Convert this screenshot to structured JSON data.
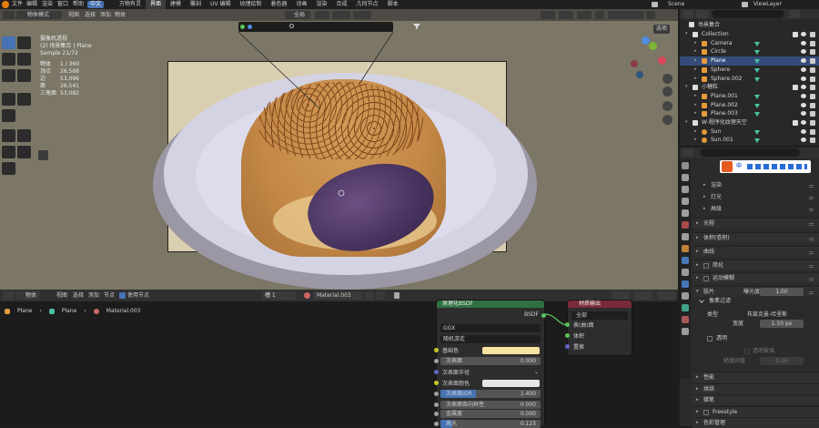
{
  "topbar": {
    "menus": [
      "文件",
      "编辑",
      "渲染",
      "窗口",
      "帮助"
    ],
    "lang_badge": "中文",
    "workspaces": [
      "万物有灵",
      "界面",
      "建模",
      "雕刻",
      "UV 编辑",
      "纹理绘制",
      "着色器",
      "动画",
      "渲染",
      "合成",
      "几何节点",
      "脚本"
    ],
    "scene_label": "Scene",
    "view_layer_label": "ViewLayer"
  },
  "viewport_header": {
    "mode": "物体模式",
    "menus": [
      "视图",
      "选择",
      "添加",
      "物体"
    ],
    "orientation": "全局",
    "options_label": "选项"
  },
  "viewport_info": {
    "view_name": "摄像机透视",
    "collection_line": "(2) 场景集合 | Plane",
    "sample": "Sample 21/72",
    "stats": [
      {
        "label": "物体",
        "value": "1 / 360"
      },
      {
        "label": "顶点",
        "value": "26,568"
      },
      {
        "label": "边",
        "value": "53,096"
      },
      {
        "label": "面",
        "value": "26,541"
      },
      {
        "label": "三角面",
        "value": "53,082"
      }
    ]
  },
  "node_header": {
    "mode": "物体",
    "menus": [
      "视图",
      "选择",
      "添加",
      "节点"
    ],
    "use_nodes_label": "使用节点",
    "slot": "槽 1",
    "material": "Material.003"
  },
  "breadcrumb": [
    "Plane",
    "Plane",
    "Material.003"
  ],
  "bsdf_node": {
    "title": "原理化BSDF",
    "output": "BSDF",
    "distribution": "GGX",
    "subsurface_method": "随机游走",
    "rows": [
      {
        "label": "基础色",
        "value": "",
        "type": "color",
        "color": "#f7e3a0"
      },
      {
        "label": "次表面",
        "value": "0.000",
        "type": "slider",
        "fill": 0
      },
      {
        "label": "次表面半径",
        "value": "",
        "type": "dropdown"
      },
      {
        "label": "次表面颜色",
        "value": "",
        "type": "color",
        "color": "#e6e6e6"
      },
      {
        "label": "次表面IOR",
        "value": "1.400",
        "type": "slider",
        "fill": 0.35
      },
      {
        "label": "次表面各向异性",
        "value": "0.000",
        "type": "slider",
        "fill": 0
      },
      {
        "label": "金属度",
        "value": "0.000",
        "type": "slider",
        "fill": 0
      },
      {
        "label": "高光",
        "value": "0.123",
        "type": "slider",
        "fill": 0.12
      }
    ]
  },
  "output_node": {
    "title": "材质输出",
    "target": "全部",
    "sockets": [
      "表(曲)面",
      "体积",
      "置换"
    ]
  },
  "outliner": {
    "root": "场景集合",
    "items": [
      {
        "label": "Collection",
        "indent": 0,
        "kind": "collection"
      },
      {
        "label": "Camera",
        "indent": 1,
        "kind": "camera"
      },
      {
        "label": "Circle",
        "indent": 1,
        "kind": "mesh"
      },
      {
        "label": "Plane",
        "indent": 1,
        "kind": "mesh",
        "selected": true
      },
      {
        "label": "Sphere",
        "indent": 1,
        "kind": "mesh"
      },
      {
        "label": "Sphere.002",
        "indent": 1,
        "kind": "mesh"
      },
      {
        "label": "小糖粒",
        "indent": 0,
        "kind": "collection"
      },
      {
        "label": "Plane.001",
        "indent": 1,
        "kind": "mesh"
      },
      {
        "label": "Plane.002",
        "indent": 1,
        "kind": "mesh"
      },
      {
        "label": "Plane.003",
        "indent": 1,
        "kind": "mesh"
      },
      {
        "label": "W-程序化纹理天空",
        "indent": 0,
        "kind": "collection"
      },
      {
        "label": "Sun",
        "indent": 1,
        "kind": "light"
      },
      {
        "label": "Sun.001",
        "indent": 1,
        "kind": "light"
      }
    ]
  },
  "ime_bar": {
    "label": "中"
  },
  "properties": {
    "sections": [
      {
        "label": "渲染",
        "level": 1
      },
      {
        "label": "灯光",
        "level": 1
      },
      {
        "label": "高级",
        "level": 1
      },
      {
        "label": "光程",
        "level": 0
      },
      {
        "label": "体积(卷积)",
        "level": 0
      },
      {
        "label": "曲线",
        "level": 0
      },
      {
        "label": "简化",
        "level": 0,
        "checkbox": true
      },
      {
        "label": "运动模糊",
        "level": 0,
        "checkbox": true
      },
      {
        "label": "胶片",
        "level": 0,
        "open": true
      }
    ],
    "exposure_label": "曝光度",
    "exposure_value": "1.00",
    "pixel_filter_label": "像素过滤",
    "type_label": "类型",
    "type_value": "布莱克曼-哈里斯",
    "width_label": "宽度",
    "width_value": "1.50 px",
    "transparent_label": "透明",
    "transparent_glass_label": "透明玻璃",
    "roughness_threshold_label": "糙度阀值",
    "roughness_threshold_value": "0.10",
    "bottom_sections": [
      "性能",
      "烘焙",
      "蜡笔",
      "Freestyle",
      "色彩管理"
    ]
  }
}
